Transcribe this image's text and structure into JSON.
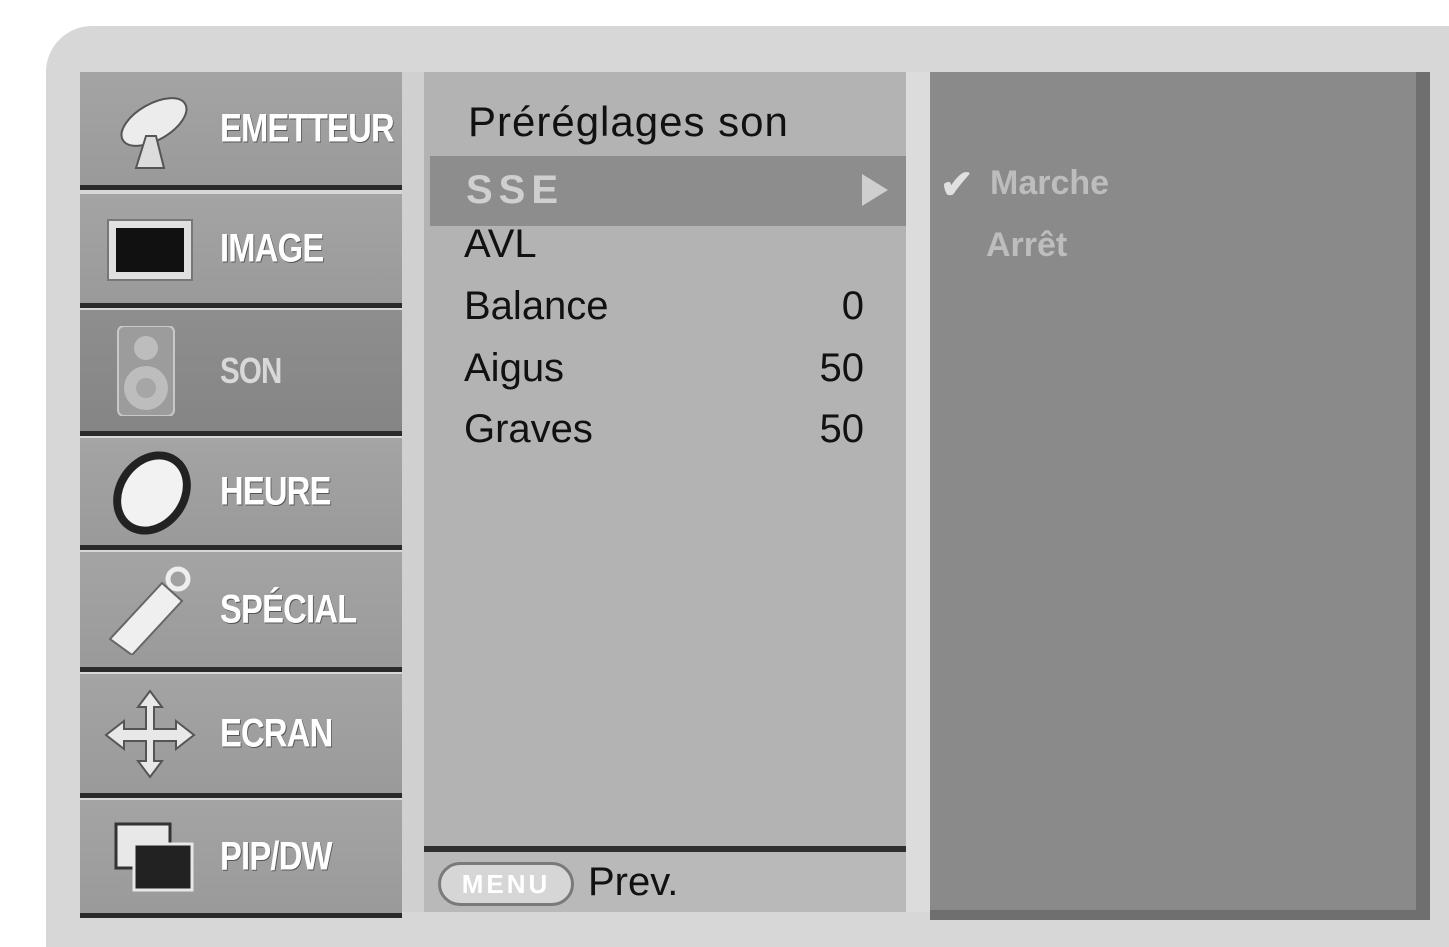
{
  "categories": [
    {
      "label": "EMETTEUR",
      "icon": "satellite-dish-icon"
    },
    {
      "label": "IMAGE",
      "icon": "picture-screen-icon"
    },
    {
      "label": "SON",
      "icon": "speaker-icon",
      "active": true
    },
    {
      "label": "HEURE",
      "icon": "clock-icon"
    },
    {
      "label": "SPÉCIAL",
      "icon": "key-tag-icon"
    },
    {
      "label": "ECRAN",
      "icon": "move-arrows-icon"
    },
    {
      "label": "PIP/DW",
      "icon": "pip-windows-icon"
    }
  ],
  "submenu": {
    "title": "Préréglages son",
    "selected": "SSE",
    "items": [
      {
        "label": "AVL",
        "value": ""
      },
      {
        "label": "Balance",
        "value": "0"
      },
      {
        "label": "Aigus",
        "value": "50"
      },
      {
        "label": "Graves",
        "value": "50"
      }
    ]
  },
  "options": {
    "checked": "Marche",
    "other": "Arrêt"
  },
  "footer": {
    "menu_button": "MENU",
    "prev_label": "Prev."
  }
}
